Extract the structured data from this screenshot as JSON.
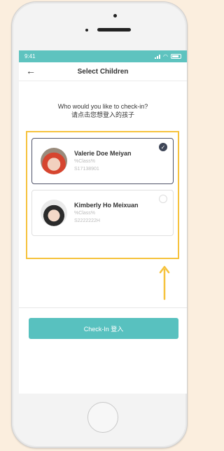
{
  "device": {
    "time": "9:41"
  },
  "screen": {
    "title": "Select Children",
    "back_icon": "←",
    "question_en": "Who would you like to check-in?",
    "question_zh": "请点击您想登入的孩子"
  },
  "children": [
    {
      "name": "Valerie Doe Meiyan",
      "class": "%Class%",
      "id": "S17138901",
      "selected": true
    },
    {
      "name": "Kimberly Ho Meixuan",
      "class": "%Class%",
      "id": "S2222222H",
      "selected": false
    }
  ],
  "actions": {
    "checkin": "Check-In  登入"
  },
  "colors": {
    "teal": "#58c1bf",
    "highlight": "#f6c23c",
    "selected_check": "#3f4657"
  },
  "icons": [
    "back-arrow-icon",
    "signal-icon",
    "wifi-icon",
    "battery-icon",
    "checkmark-icon",
    "radio-empty-icon",
    "up-arrow-icon"
  ]
}
